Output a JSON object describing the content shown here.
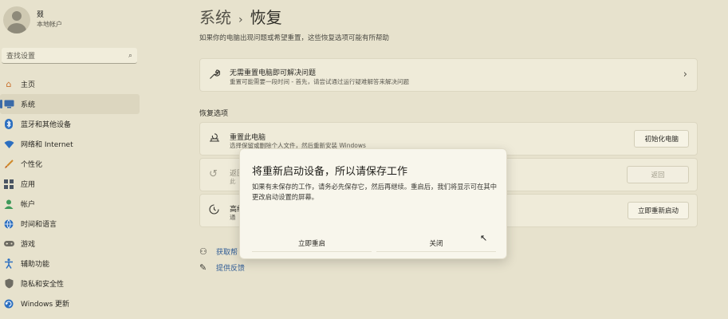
{
  "sidebar": {
    "user": {
      "name": "叕",
      "account_type": "本地帐户"
    },
    "search": {
      "placeholder": "查找设置"
    },
    "items": [
      {
        "label": "主页",
        "icon": "home-icon"
      },
      {
        "label": "系统",
        "icon": "monitor-icon",
        "selected": true
      },
      {
        "label": "蓝牙和其他设备",
        "icon": "bluetooth-icon"
      },
      {
        "label": "网络和 Internet",
        "icon": "wifi-icon"
      },
      {
        "label": "个性化",
        "icon": "brush-icon"
      },
      {
        "label": "应用",
        "icon": "apps-icon"
      },
      {
        "label": "帐户",
        "icon": "person-icon"
      },
      {
        "label": "时间和语言",
        "icon": "globe-icon"
      },
      {
        "label": "游戏",
        "icon": "gamepad-icon"
      },
      {
        "label": "辅助功能",
        "icon": "accessibility-icon"
      },
      {
        "label": "隐私和安全性",
        "icon": "shield-icon"
      },
      {
        "label": "Windows 更新",
        "icon": "update-icon"
      }
    ]
  },
  "main": {
    "breadcrumb": {
      "parent": "系统",
      "separator": "›",
      "current": "恢复"
    },
    "description": "如果你的电脑出现问题或希望重置，这些恢复选项可能有所帮助",
    "troubleshoot": {
      "title": "无需重置电脑即可解决问题",
      "desc": "重置可能需要一段时间 - 首先，请尝试通过运行疑难解答来解决问题"
    },
    "section_title": "恢复选项",
    "reset": {
      "title": "重置此电脑",
      "desc": "选择保留或删除个人文件，然后重新安装 Windows",
      "button": "初始化电脑"
    },
    "goback": {
      "title_partial": "返回",
      "desc_partial": "此",
      "button": "返回"
    },
    "advanced": {
      "title_partial": "高级",
      "desc_partial": "通",
      "button": "立即重新启动"
    },
    "links": [
      {
        "label": "获取帮助",
        "label_visible": "获取帮",
        "icon": "help-icon"
      },
      {
        "label": "提供反馈",
        "icon": "feedback-icon"
      }
    ]
  },
  "dialog": {
    "title": "将重新启动设备，所以请保存工作",
    "body": "如果有未保存的工作，请务必先保存它，然后再继续。重启后，我们将显示可在其中更改启动设置的屏幕。",
    "primary_button": "立即重启",
    "secondary_button": "关闭"
  },
  "colors": {
    "background": "#e7e2cd",
    "accent": "#3a6aa8",
    "link": "#2f5c96"
  }
}
